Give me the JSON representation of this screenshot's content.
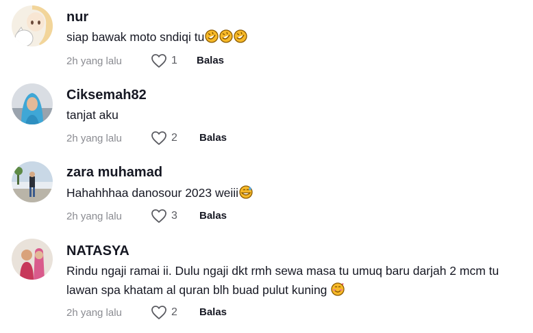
{
  "comments": [
    {
      "username": "nur",
      "text": "siap bawak moto sndiqi tu",
      "emojis": [
        "rofl-emoji",
        "rofl-emoji",
        "rofl-emoji"
      ],
      "time": "2h yang lalu",
      "likes": "1",
      "reply_label": "Balas"
    },
    {
      "username": "Ciksemah82",
      "text": "tanjat aku",
      "emojis": [],
      "time": "2h yang lalu",
      "likes": "2",
      "reply_label": "Balas"
    },
    {
      "username": "zara muhamad",
      "text": "Hahahhhaa danosour 2023 weiii",
      "emojis": [
        "grinning-sweat-emoji"
      ],
      "time": "2h yang lalu",
      "likes": "3",
      "reply_label": "Balas"
    },
    {
      "username": "NATASYA",
      "text": "Rindu ngaji ramai ii. Dulu ngaji dkt rmh sewa masa tu umuq baru darjah 2 mcm tu lawan spa khatam al quran blh buad pulut kuning",
      "emojis": [
        "smiling-hearts-emoji"
      ],
      "time": "2h yang lalu",
      "likes": "2",
      "reply_label": "Balas"
    }
  ],
  "icons": {
    "like": "heart-outline-icon"
  },
  "colors": {
    "text": "#161823",
    "muted": "#8a8b91",
    "emoji_yellow": "#f7b928"
  }
}
